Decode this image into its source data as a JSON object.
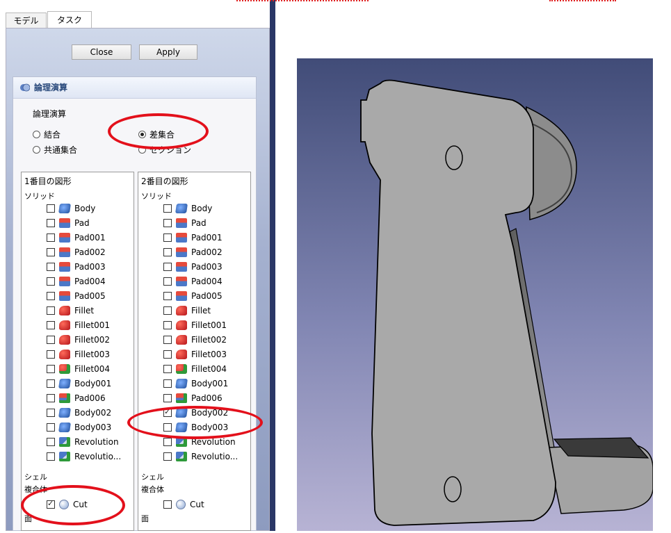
{
  "tabs": [
    {
      "label": "モデル"
    },
    {
      "label": "タスク"
    }
  ],
  "buttons": {
    "close": "Close",
    "apply": "Apply"
  },
  "panel": {
    "title": "論理演算",
    "group_title": "論理演算",
    "radios": [
      {
        "label": "結合",
        "checked": false
      },
      {
        "label": "差集合",
        "checked": true
      },
      {
        "label": "共通集合",
        "checked": false
      },
      {
        "label": "セクション",
        "checked": false
      }
    ]
  },
  "list1": {
    "title": "1番目の図形",
    "cat_solid": "ソリッド",
    "cat_shell": "シェル",
    "cat_compound": "複合体",
    "cat_face": "面",
    "items": [
      {
        "label": "Body",
        "icon": "body-icon",
        "checked": false
      },
      {
        "label": "Pad",
        "icon": "pad-icon",
        "checked": false
      },
      {
        "label": "Pad001",
        "icon": "pad-icon",
        "checked": false
      },
      {
        "label": "Pad002",
        "icon": "pad-icon",
        "checked": false
      },
      {
        "label": "Pad003",
        "icon": "pad-icon",
        "checked": false
      },
      {
        "label": "Pad004",
        "icon": "pad-icon",
        "checked": false
      },
      {
        "label": "Pad005",
        "icon": "pad-icon",
        "checked": false
      },
      {
        "label": "Fillet",
        "icon": "fillet-icon",
        "checked": false
      },
      {
        "label": "Fillet001",
        "icon": "fillet-icon",
        "checked": false
      },
      {
        "label": "Fillet002",
        "icon": "fillet-icon",
        "checked": false
      },
      {
        "label": "Fillet003",
        "icon": "fillet-icon",
        "checked": false
      },
      {
        "label": "Fillet004",
        "icon": "fillet-green-icon",
        "checked": false
      },
      {
        "label": "Body001",
        "icon": "body-icon",
        "checked": false
      },
      {
        "label": "Pad006",
        "icon": "pad-green-icon",
        "checked": false
      },
      {
        "label": "Body002",
        "icon": "body-icon",
        "checked": false
      },
      {
        "label": "Body003",
        "icon": "body-icon",
        "checked": false
      },
      {
        "label": "Revolution",
        "icon": "revolution-icon",
        "checked": false
      },
      {
        "label": "Revolutio...",
        "icon": "revolution-icon",
        "checked": false
      }
    ],
    "compound_items": [
      {
        "label": "Cut",
        "icon": "cut-icon",
        "checked": true
      }
    ]
  },
  "list2": {
    "title": "2番目の図形",
    "cat_solid": "ソリッド",
    "cat_shell": "シェル",
    "cat_compound": "複合体",
    "cat_face": "面",
    "items": [
      {
        "label": "Body",
        "icon": "body-icon",
        "checked": false
      },
      {
        "label": "Pad",
        "icon": "pad-icon",
        "checked": false
      },
      {
        "label": "Pad001",
        "icon": "pad-icon",
        "checked": false
      },
      {
        "label": "Pad002",
        "icon": "pad-icon",
        "checked": false
      },
      {
        "label": "Pad003",
        "icon": "pad-icon",
        "checked": false
      },
      {
        "label": "Pad004",
        "icon": "pad-icon",
        "checked": false
      },
      {
        "label": "Pad005",
        "icon": "pad-icon",
        "checked": false
      },
      {
        "label": "Fillet",
        "icon": "fillet-icon",
        "checked": false
      },
      {
        "label": "Fillet001",
        "icon": "fillet-icon",
        "checked": false
      },
      {
        "label": "Fillet002",
        "icon": "fillet-icon",
        "checked": false
      },
      {
        "label": "Fillet003",
        "icon": "fillet-icon",
        "checked": false
      },
      {
        "label": "Fillet004",
        "icon": "fillet-green-icon",
        "checked": false
      },
      {
        "label": "Body001",
        "icon": "body-icon",
        "checked": false
      },
      {
        "label": "Pad006",
        "icon": "pad-green-icon",
        "checked": false
      },
      {
        "label": "Body002",
        "icon": "body-icon",
        "checked": true
      },
      {
        "label": "Body003",
        "icon": "body-icon",
        "checked": false
      },
      {
        "label": "Revolution",
        "icon": "revolution-icon",
        "checked": false
      },
      {
        "label": "Revolutio...",
        "icon": "revolution-icon",
        "checked": false
      }
    ],
    "compound_items": [
      {
        "label": "Cut",
        "icon": "cut-icon",
        "checked": false
      }
    ]
  },
  "colors": {
    "accent_red": "#e3101b",
    "viewport_top": "#414c78",
    "viewport_bottom": "#b7b3d4",
    "header_text": "#2a4a7c"
  }
}
